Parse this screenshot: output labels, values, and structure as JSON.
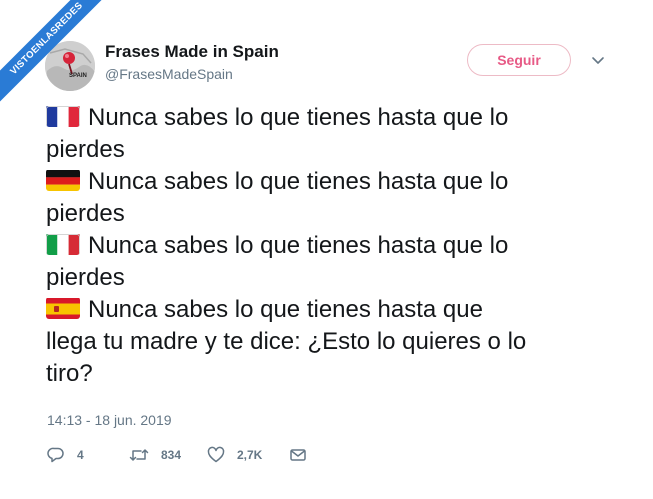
{
  "watermark": {
    "text": "VISTOENLASREDES"
  },
  "profile": {
    "name": "Frases Made in Spain",
    "handle": "@FrasesMadeSpain",
    "avatar_label": "SPAIN",
    "avatar_icon": "map-pin-icon"
  },
  "follow_button": {
    "label": "Seguir",
    "color": "#e0245e"
  },
  "tweet": {
    "lines": [
      {
        "flag": "france",
        "text": "Nunca sabes lo que tienes hasta que lo"
      },
      {
        "text": "pierdes"
      },
      {
        "flag": "germany",
        "text": "Nunca sabes lo que tienes hasta que lo"
      },
      {
        "text": "pierdes"
      },
      {
        "flag": "italy",
        "text": "Nunca sabes lo que tienes hasta que lo"
      },
      {
        "text": "pierdes"
      },
      {
        "flag": "spain",
        "text": "Nunca sabes lo que tienes hasta que"
      },
      {
        "text": "llega tu madre y te dice: ¿Esto lo quieres o lo"
      },
      {
        "text": "tiro?"
      }
    ]
  },
  "timestamp": "14:13 - 18 jun. 2019",
  "actions": {
    "reply": {
      "icon": "reply-icon",
      "count": "4"
    },
    "retweet": {
      "icon": "retweet-icon",
      "count": "834"
    },
    "like": {
      "icon": "heart-icon",
      "count": "2,7K"
    },
    "message": {
      "icon": "envelope-icon"
    }
  }
}
